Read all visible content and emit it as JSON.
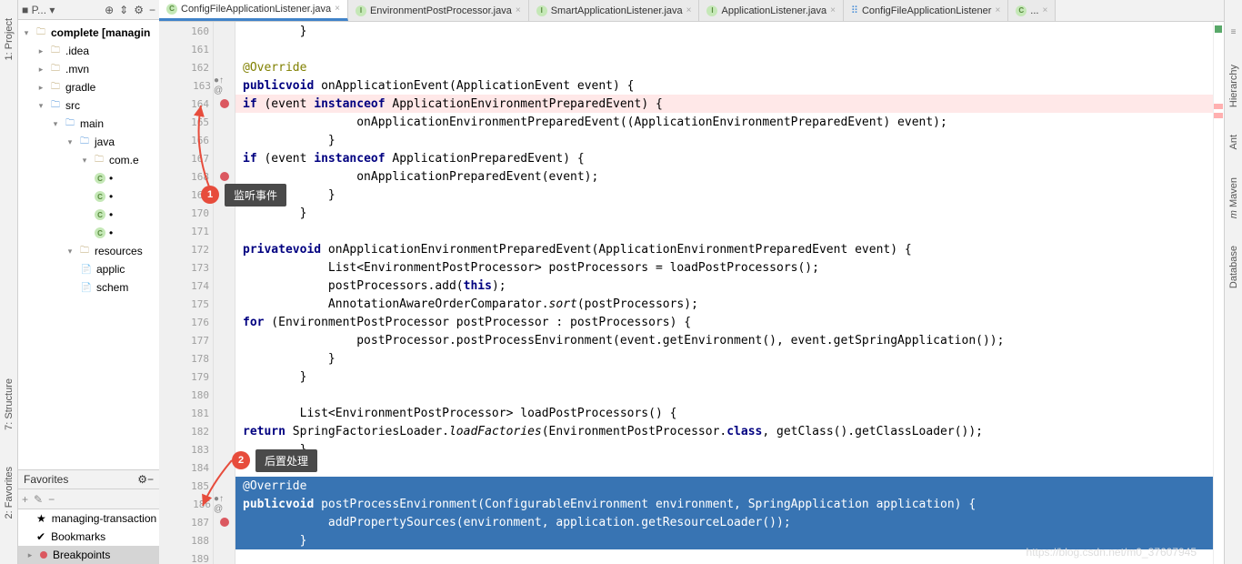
{
  "leftRail": {
    "project": "1: Project",
    "structure": "7: Structure",
    "favorites": "2: Favorites"
  },
  "projectHead": "P...",
  "tree": {
    "root": "complete [managin",
    "idea": ".idea",
    "mvn": ".mvn",
    "gradle": "gradle",
    "src": "src",
    "main": "main",
    "java": "java",
    "pkg": "com.e",
    "resources": "resources",
    "applic": "applic",
    "schem": "schem"
  },
  "favorites": {
    "title": "Favorites",
    "managing": "managing-transaction",
    "bookmarks": "Bookmarks",
    "breakpoints": "Breakpoints"
  },
  "tabs": [
    {
      "icon": "c",
      "label": "ConfigFileApplicationListener.java",
      "active": true
    },
    {
      "icon": "i",
      "label": "EnvironmentPostProcessor.java"
    },
    {
      "icon": "i",
      "label": "SmartApplicationListener.java"
    },
    {
      "icon": "i",
      "label": "ApplicationListener.java"
    },
    {
      "icon": "x",
      "label": "ConfigFileApplicationListener"
    },
    {
      "icon": "c",
      "label": "..."
    }
  ],
  "annotations": {
    "badge1": "1",
    "tip1": "监听事件",
    "badge2": "2",
    "tip2": "后置处理"
  },
  "lines": [
    {
      "n": 160,
      "t": "        }"
    },
    {
      "n": 161,
      "t": ""
    },
    {
      "n": 162,
      "t": "        @Override",
      "cls": "ann"
    },
    {
      "n": 163,
      "t": "        public void onApplicationEvent(ApplicationEvent event) {",
      "ov": true
    },
    {
      "n": 164,
      "t": "            if (event instanceof ApplicationEnvironmentPreparedEvent) {",
      "bp": true,
      "hl": "red"
    },
    {
      "n": 165,
      "t": "                onApplicationEnvironmentPreparedEvent((ApplicationEnvironmentPreparedEvent) event);"
    },
    {
      "n": 166,
      "t": "            }"
    },
    {
      "n": 167,
      "t": "            if (event instanceof ApplicationPreparedEvent) {"
    },
    {
      "n": 168,
      "t": "                onApplicationPreparedEvent(event);",
      "bp": true
    },
    {
      "n": 169,
      "t": "            }"
    },
    {
      "n": 170,
      "t": "        }"
    },
    {
      "n": 171,
      "t": ""
    },
    {
      "n": 172,
      "t": "        private void onApplicationEnvironmentPreparedEvent(ApplicationEnvironmentPreparedEvent event) {"
    },
    {
      "n": 173,
      "t": "            List<EnvironmentPostProcessor> postProcessors = loadPostProcessors();"
    },
    {
      "n": 174,
      "t": "            postProcessors.add(this);"
    },
    {
      "n": 175,
      "t": "            AnnotationAwareOrderComparator.sort(postProcessors);"
    },
    {
      "n": 176,
      "t": "            for (EnvironmentPostProcessor postProcessor : postProcessors) {"
    },
    {
      "n": 177,
      "t": "                postProcessor.postProcessEnvironment(event.getEnvironment(), event.getSpringApplication());"
    },
    {
      "n": 178,
      "t": "            }"
    },
    {
      "n": 179,
      "t": "        }"
    },
    {
      "n": 180,
      "t": ""
    },
    {
      "n": 181,
      "t": "        List<EnvironmentPostProcessor> loadPostProcessors() {"
    },
    {
      "n": 182,
      "t": "            return SpringFactoriesLoader.loadFactories(EnvironmentPostProcessor.class, getClass().getClassLoader());"
    },
    {
      "n": 183,
      "t": "        }"
    },
    {
      "n": 184,
      "t": ""
    },
    {
      "n": 185,
      "t": "        @Override",
      "sel": true,
      "cls": "ann"
    },
    {
      "n": 186,
      "t": "        public void postProcessEnvironment(ConfigurableEnvironment environment, SpringApplication application) {",
      "sel": true,
      "ov": true
    },
    {
      "n": 187,
      "t": "            addPropertySources(environment, application.getResourceLoader());",
      "sel": true,
      "bp": true
    },
    {
      "n": 188,
      "t": "        }",
      "sel": true
    },
    {
      "n": 189,
      "t": ""
    }
  ],
  "rightRail": {
    "hierarchy": "Hierarchy",
    "ant": "Ant",
    "maven": "Maven",
    "database": "Database"
  },
  "watermark": "https://blog.csdn.net/m0_37607945"
}
